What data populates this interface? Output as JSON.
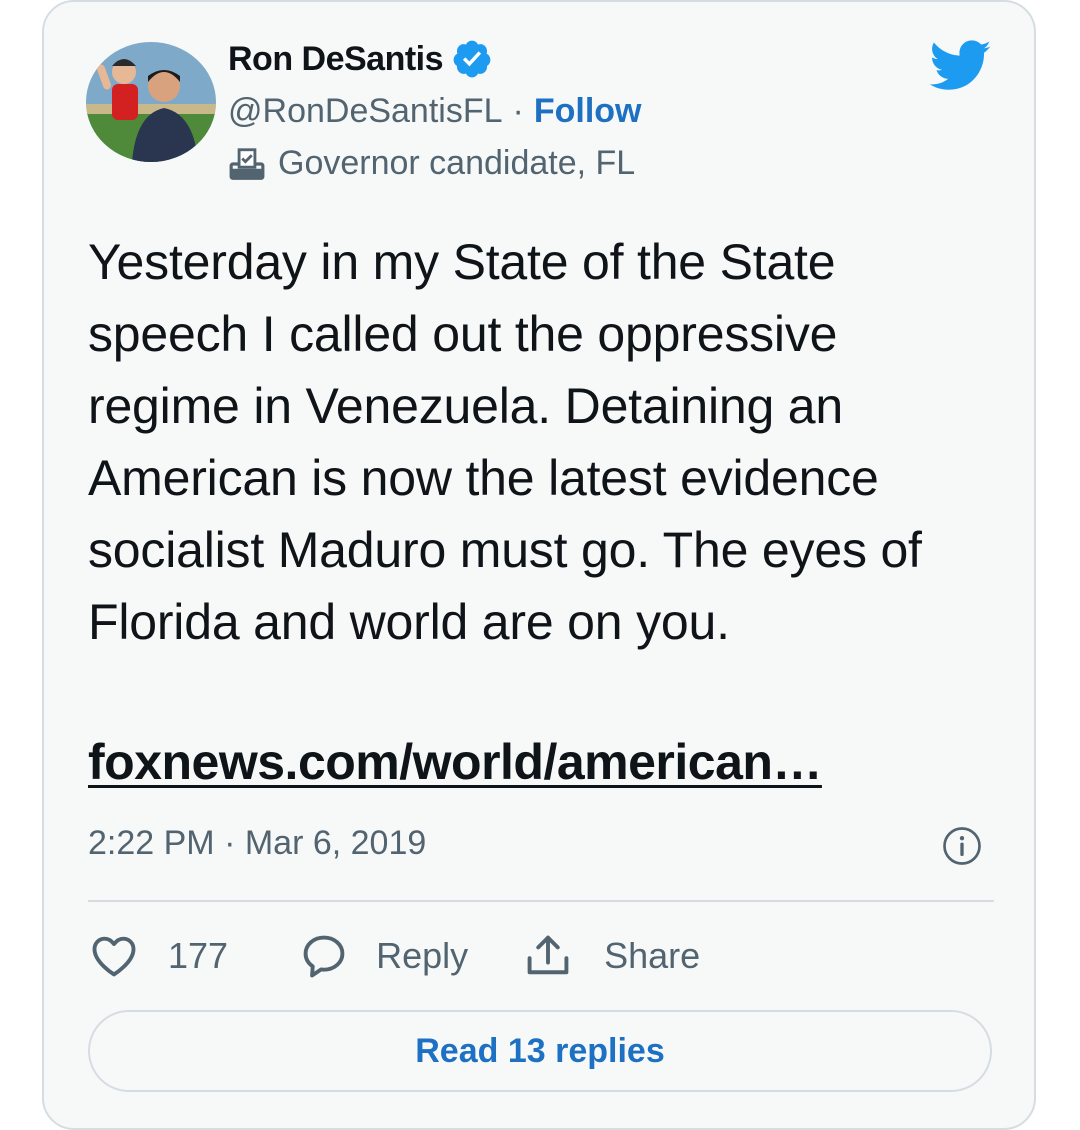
{
  "author": {
    "name": "Ron DeSantis",
    "handle": "@RonDeSantisFL",
    "separator": "·",
    "follow_label": "Follow",
    "label": "Governor candidate, FL",
    "verified": true
  },
  "tweet": {
    "text": "Yesterday in my State of the State speech I called out the oppressive regime in Venezuela. Detaining an American is now the latest evidence socialist Maduro must go. The eyes of Florida and world are on you.",
    "link": "foxnews.com/world/american…",
    "timestamp": "2:22 PM · Mar 6, 2019"
  },
  "actions": {
    "like_count": "177",
    "reply_label": "Reply",
    "share_label": "Share"
  },
  "read_replies_label": "Read 13 replies",
  "icons": {
    "brand": "twitter-bird-icon",
    "verified": "verified-badge-icon",
    "label": "ballot-box-icon",
    "info": "info-icon",
    "like": "heart-icon",
    "reply": "speech-bubble-icon",
    "share": "share-upload-icon"
  },
  "colors": {
    "accent": "#1d9bf0",
    "link_blue": "#1d70c2",
    "text": "#0f1419",
    "muted": "#536471"
  }
}
